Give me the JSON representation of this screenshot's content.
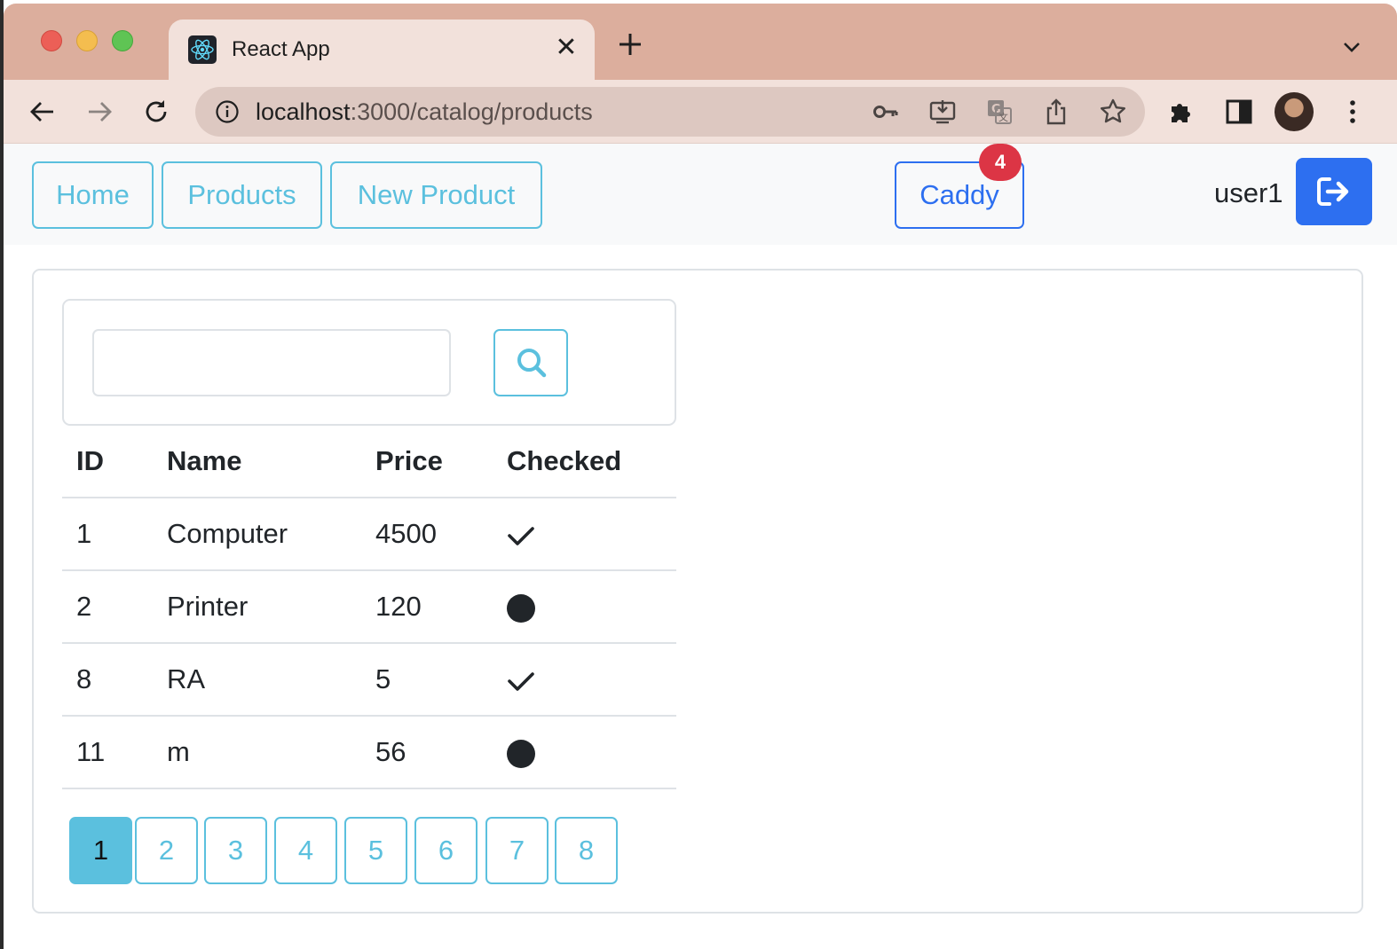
{
  "browser": {
    "tab_title": "React App",
    "url_host": "localhost",
    "url_rest": ":3000/catalog/products"
  },
  "nav": {
    "home": "Home",
    "products": "Products",
    "new_product": "New Product",
    "caddy": "Caddy",
    "caddy_count": "4",
    "username": "user1"
  },
  "search": {
    "value": "",
    "placeholder": ""
  },
  "table": {
    "headers": [
      "ID",
      "Name",
      "Price",
      "Checked"
    ],
    "rows": [
      {
        "id": "1",
        "name": "Computer",
        "price": "4500",
        "checked": true
      },
      {
        "id": "2",
        "name": "Printer",
        "price": "120",
        "checked": false
      },
      {
        "id": "8",
        "name": "RA",
        "price": "5",
        "checked": true
      },
      {
        "id": "11",
        "name": "m",
        "price": "56",
        "checked": false
      }
    ]
  },
  "pagination": {
    "pages": [
      "1",
      "2",
      "3",
      "4",
      "5",
      "6",
      "7",
      "8"
    ],
    "current": "1"
  },
  "colors": {
    "info": "#5bc0de",
    "primary": "#2d6ff0",
    "danger": "#dc3545",
    "dark": "#212529"
  }
}
